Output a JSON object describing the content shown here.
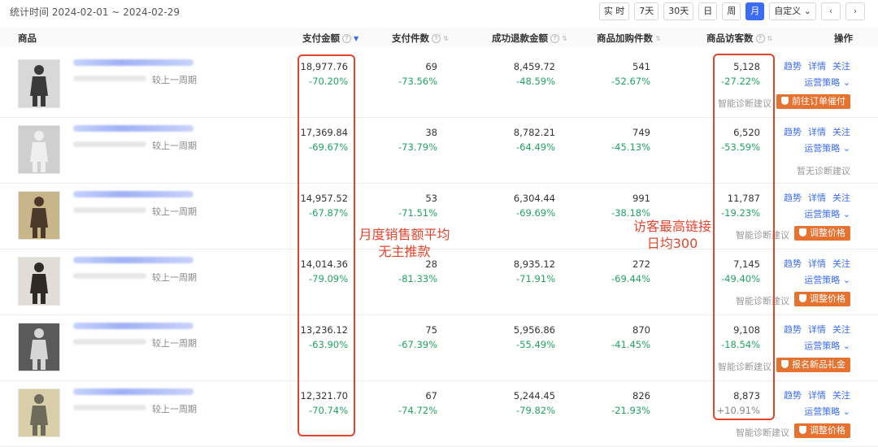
{
  "header": {
    "stat_period": "统计时间 2024-02-01 ~ 2024-02-29",
    "ranges": [
      "实 时",
      "7天",
      "30天",
      "日",
      "周",
      "月",
      "自定义"
    ],
    "active_range": "月",
    "custom_suffix": "⌄",
    "prev": "‹",
    "next": "›"
  },
  "table": {
    "columns": {
      "product": "商品",
      "pay_amount": "支付金额",
      "pay_count": "支付件数",
      "refund_amount": "成功退款金额",
      "cart_count": "商品加购件数",
      "visitors": "商品访客数",
      "actions": "操作"
    },
    "compare_label": "较上一周期",
    "ops": {
      "trend": "趋势",
      "detail": "详情",
      "follow": "关注",
      "strategy": "运营策略 ⌄"
    },
    "diag_label": "智能诊断建议",
    "no_diag_label": "暂无诊断建议",
    "rows": [
      {
        "pay": "18,977.76",
        "pay_c": "-70.20%",
        "cnt": "69",
        "cnt_c": "-73.56%",
        "refund": "8,459.72",
        "refund_c": "-48.59%",
        "cart": "541",
        "cart_c": "-52.67%",
        "visit": "5,128",
        "visit_c": "-27.22%",
        "diag": "前往订单催付"
      },
      {
        "pay": "17,369.84",
        "pay_c": "-69.67%",
        "cnt": "38",
        "cnt_c": "-73.79%",
        "refund": "8,782.21",
        "refund_c": "-64.49%",
        "cart": "749",
        "cart_c": "-45.13%",
        "visit": "6,520",
        "visit_c": "-53.59%",
        "diag": ""
      },
      {
        "pay": "14,957.52",
        "pay_c": "-67.87%",
        "cnt": "53",
        "cnt_c": "-71.51%",
        "refund": "6,304.44",
        "refund_c": "-69.69%",
        "cart": "991",
        "cart_c": "-38.18%",
        "visit": "11,787",
        "visit_c": "-19.23%",
        "diag": "调整价格"
      },
      {
        "pay": "14,014.36",
        "pay_c": "-79.09%",
        "cnt": "28",
        "cnt_c": "-81.33%",
        "refund": "8,935.12",
        "refund_c": "-71.91%",
        "cart": "272",
        "cart_c": "-69.44%",
        "visit": "7,145",
        "visit_c": "-49.40%",
        "diag": "调整价格"
      },
      {
        "pay": "13,236.12",
        "pay_c": "-63.90%",
        "cnt": "75",
        "cnt_c": "-67.39%",
        "refund": "5,956.86",
        "refund_c": "-55.49%",
        "cart": "870",
        "cart_c": "-41.45%",
        "visit": "9,108",
        "visit_c": "-18.54%",
        "diag": "报名新品礼金"
      },
      {
        "pay": "12,321.70",
        "pay_c": "-70.74%",
        "cnt": "67",
        "cnt_c": "-74.72%",
        "refund": "5,244.45",
        "refund_c": "-79.82%",
        "cart": "826",
        "cart_c": "-21.93%",
        "visit": "8,873",
        "visit_c": "+10.91%",
        "diag": "调整价格"
      }
    ]
  },
  "annotations": {
    "left_note": [
      "月度销售额平均",
      "无主推款"
    ],
    "right_note": [
      "访客最高链接",
      "日均300"
    ],
    "color": "#e2452e"
  }
}
